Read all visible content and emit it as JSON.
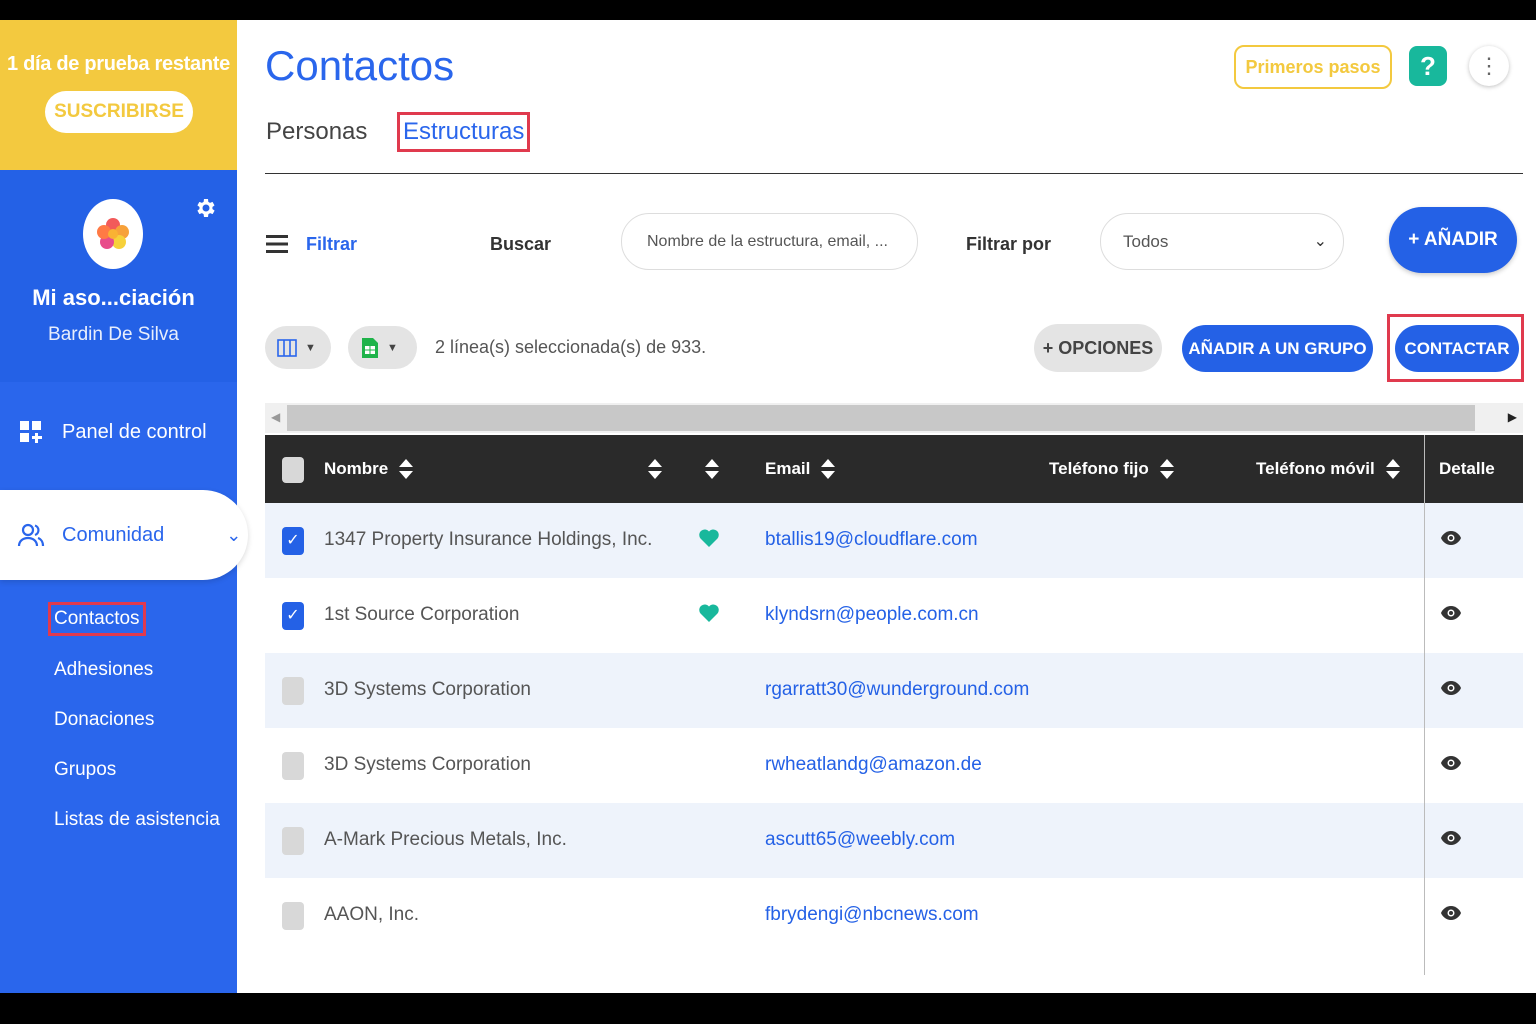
{
  "trial": {
    "text": "1 día de prueba restante",
    "subscribe": "SUSCRIBIRSE"
  },
  "profile": {
    "org": "Mi aso...ciación",
    "user": "Bardin De Silva"
  },
  "nav": {
    "panel": "Panel de control",
    "community": "Comunidad",
    "sub": [
      "Contactos",
      "Adhesiones",
      "Donaciones",
      "Grupos",
      "Listas de asistencia"
    ]
  },
  "header": {
    "title": "Contactos",
    "first_steps": "Primeros pasos",
    "help": "?"
  },
  "tabs": [
    "Personas",
    "Estructuras"
  ],
  "toolbar": {
    "filter": "Filtrar",
    "search_label": "Buscar",
    "search_placeholder": "Nombre de la estructura, email, ...",
    "filter_by": "Filtrar por",
    "filter_value": "Todos",
    "add": "+ AÑADIR"
  },
  "actions": {
    "selection": "2 línea(s) seleccionada(s) de 933.",
    "options": "+ OPCIONES",
    "add_group": "AÑADIR A UN GRUPO",
    "contact": "CONTACTAR"
  },
  "table": {
    "headers": {
      "name": "Nombre",
      "email": "Email",
      "phone": "Teléfono fijo",
      "mobile": "Teléfono móvil",
      "detail": "Detalle"
    },
    "rows": [
      {
        "name": "1347 Property Insurance Holdings, Inc.",
        "email": "btallis19@cloudflare.com",
        "checked": true,
        "favorite": true
      },
      {
        "name": "1st Source Corporation",
        "email": "klyndsrn@people.com.cn",
        "checked": true,
        "favorite": true
      },
      {
        "name": "3D Systems Corporation",
        "email": "rgarratt30@wunderground.com",
        "checked": false,
        "favorite": false
      },
      {
        "name": "3D Systems Corporation",
        "email": "rwheatlandg@amazon.de",
        "checked": false,
        "favorite": false
      },
      {
        "name": "A-Mark Precious Metals, Inc.",
        "email": "ascutt65@weebly.com",
        "checked": false,
        "favorite": false
      },
      {
        "name": "AAON, Inc.",
        "email": "fbrydengi@nbcnews.com",
        "checked": false,
        "favorite": false
      }
    ]
  },
  "colors": {
    "brand_blue": "#2461e6",
    "trial_yellow": "#f3c93f",
    "help_green": "#18b89c",
    "highlight_red": "#e03a4e"
  }
}
